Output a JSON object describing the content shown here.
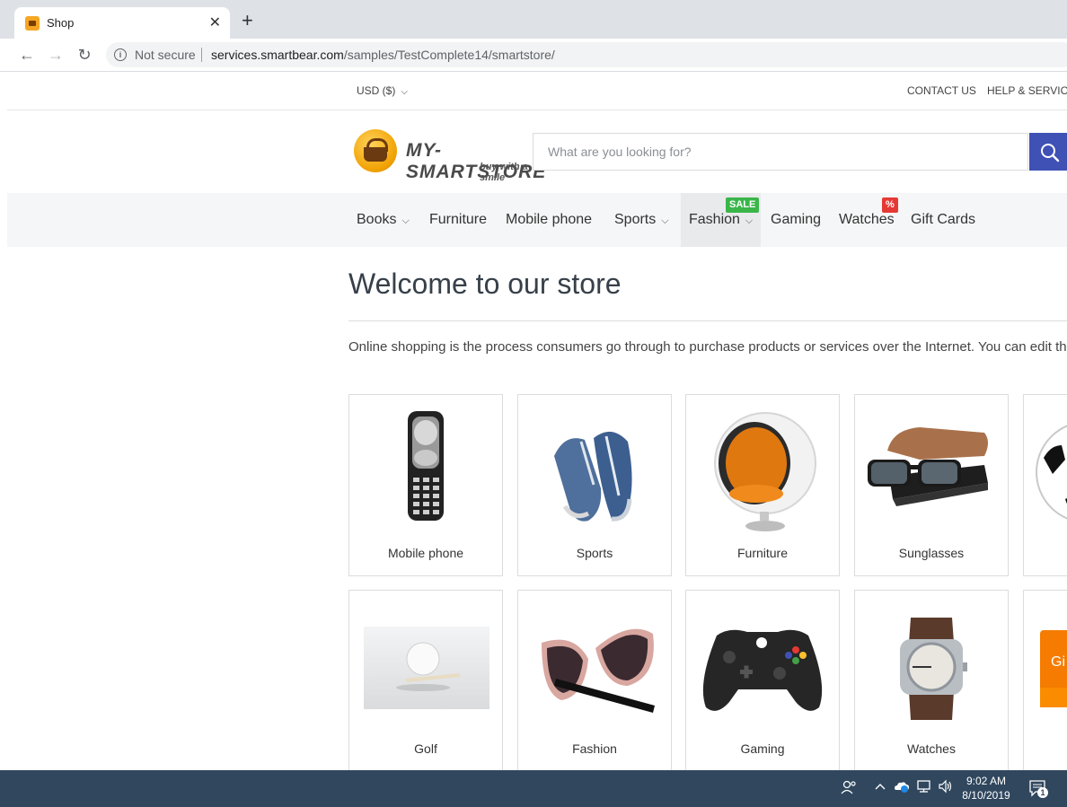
{
  "browser": {
    "tab_title": "Shop",
    "close_glyph": "✕",
    "new_tab_glyph": "+",
    "back_glyph": "←",
    "forward_glyph": "→",
    "reload_glyph": "↻",
    "security_text": "Not secure",
    "url_host": "services.smartbear.com",
    "url_path": "/samples/TestComplete14/smartstore/"
  },
  "topbar": {
    "currency": "USD  ($)",
    "links": [
      "CONTACT US",
      "HELP & SERVICES"
    ]
  },
  "header": {
    "logo_text": "MY-SMARTSTORE",
    "logo_tagline": "buy with a smile",
    "search_placeholder": "What are you looking for?",
    "accent_color": "#3f51b5"
  },
  "menu": {
    "items": [
      {
        "label": "Books",
        "dropdown": true
      },
      {
        "label": "Furniture",
        "dropdown": false
      },
      {
        "label": "Mobile phone",
        "dropdown": false
      },
      {
        "label": "Sports",
        "dropdown": true
      },
      {
        "label": "Fashion",
        "dropdown": true,
        "badge": "SALE"
      },
      {
        "label": "Gaming",
        "dropdown": false
      },
      {
        "label": "Watches",
        "dropdown": false,
        "badge": "%"
      },
      {
        "label": "Gift Cards",
        "dropdown": false
      }
    ]
  },
  "main": {
    "title": "Welcome to our store",
    "intro": "Online shopping is the process consumers go through to purchase products or services over the Internet. You can edit this in the admin site.",
    "categories": [
      {
        "label": "Mobile phone",
        "icon": "mobile-phone-icon"
      },
      {
        "label": "Sports",
        "icon": "sneakers-icon"
      },
      {
        "label": "Furniture",
        "icon": "ball-chair-icon"
      },
      {
        "label": "Sunglasses",
        "icon": "sunglasses-icon"
      },
      {
        "label": "",
        "icon": "soccer-ball-icon"
      },
      {
        "label": "Golf",
        "icon": "golf-ball-icon"
      },
      {
        "label": "Fashion",
        "icon": "fashion-glasses-icon"
      },
      {
        "label": "Gaming",
        "icon": "game-controller-icon"
      },
      {
        "label": "Watches",
        "icon": "wristwatch-icon"
      },
      {
        "label": "",
        "icon": "gift-card-icon"
      }
    ],
    "gift_card_text": "Gi"
  },
  "taskbar": {
    "time": "9:02 AM",
    "date": "8/10/2019",
    "notification_count": "1"
  }
}
